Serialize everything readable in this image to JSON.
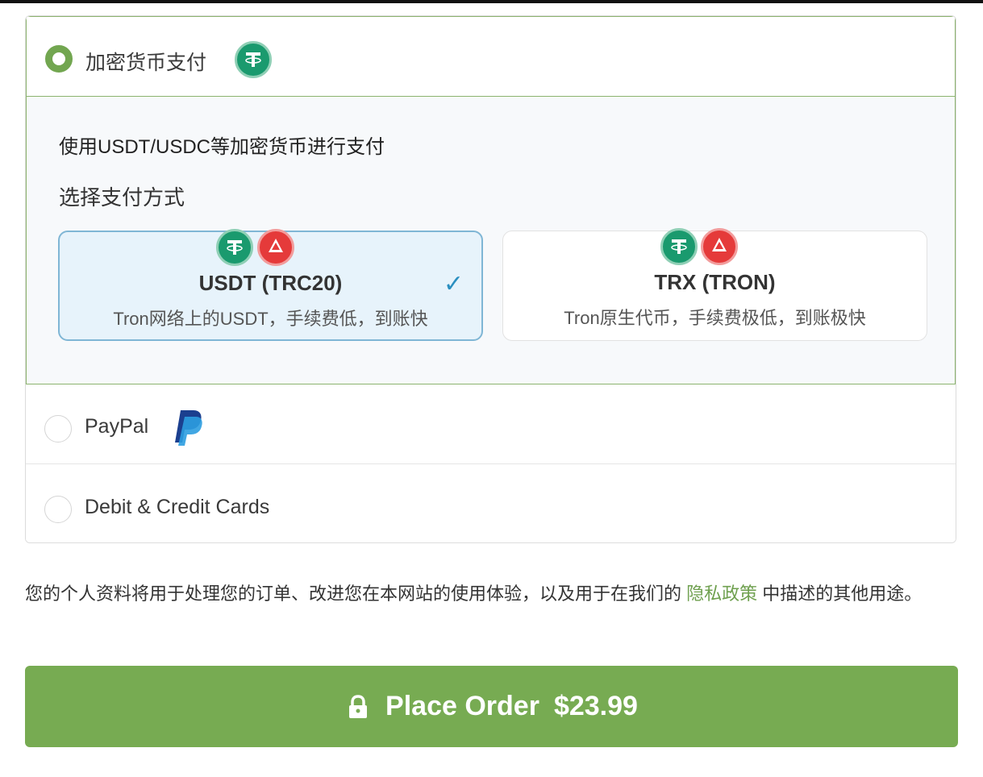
{
  "payment": {
    "crypto": {
      "label": "加密货币支付",
      "icon": "usdt-coin-icon",
      "description": "使用USDT/USDC等加密货币进行支付",
      "choose_title": "选择支付方式",
      "options": [
        {
          "name": "USDT (TRC20)",
          "subtitle": "Tron网络上的USDT，手续费低，到账快",
          "selected": true,
          "icons": [
            "usdt-coin-icon",
            "tron-coin-icon"
          ]
        },
        {
          "name": "TRX (TRON)",
          "subtitle": "Tron原生代币，手续费极低，到账极快",
          "selected": false,
          "icons": [
            "usdt-coin-icon",
            "tron-coin-icon"
          ]
        }
      ]
    },
    "paypal": {
      "label": "PayPal",
      "icon": "paypal-logo-icon"
    },
    "cards": {
      "label": "Debit & Credit Cards"
    }
  },
  "privacy": {
    "text_before": "您的个人资料将用于处理您的订单、改进您在本网站的使用体验，以及用于在我们的 ",
    "link_text": "隐私政策",
    "text_after": " 中描述的其他用途。"
  },
  "order_button": {
    "label": "Place Order",
    "price": "$23.99"
  },
  "colors": {
    "accent_green": "#77ab52",
    "link_green": "#6fa04f",
    "selected_blue": "#2a8fc0",
    "usdt_green": "#1a9a6e",
    "tron_red": "#e53a3a"
  }
}
